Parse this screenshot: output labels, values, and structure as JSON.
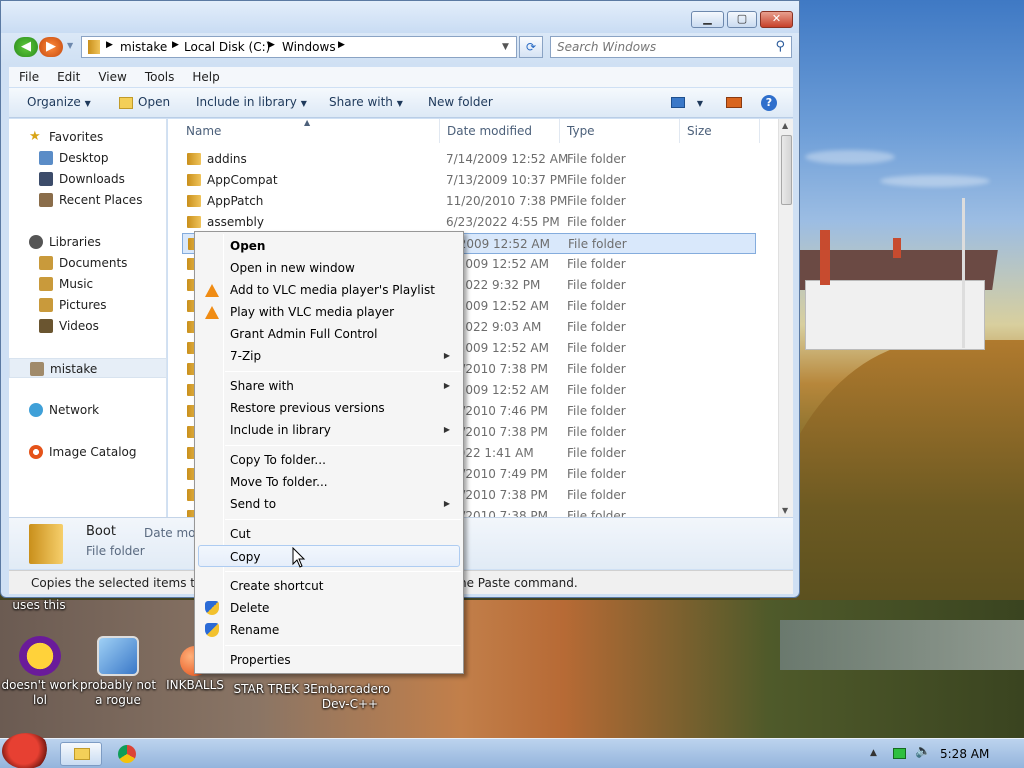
{
  "window": {
    "address": {
      "segments": [
        "mistake",
        "Local Disk (C:)",
        "Windows"
      ]
    },
    "search": {
      "placeholder": "Search Windows"
    },
    "menu": [
      "File",
      "Edit",
      "View",
      "Tools",
      "Help"
    ],
    "commands": {
      "organize": "Organize",
      "open": "Open",
      "include_in_library": "Include in library",
      "share_with": "Share with",
      "new_folder": "New folder"
    },
    "nav": {
      "favorites": "Favorites",
      "desktop": "Desktop",
      "downloads": "Downloads",
      "recent_places": "Recent Places",
      "libraries": "Libraries",
      "documents": "Documents",
      "music": "Music",
      "pictures": "Pictures",
      "videos": "Videos",
      "mistake": "mistake",
      "network": "Network",
      "image_catalog": "Image Catalog"
    },
    "columns": {
      "name": "Name",
      "date": "Date modified",
      "type": "Type",
      "size": "Size"
    },
    "files": [
      {
        "name": "addins",
        "date": "7/14/2009 12:52 AM",
        "type": "File folder"
      },
      {
        "name": "AppCompat",
        "date": "7/13/2009 10:37 PM",
        "type": "File folder"
      },
      {
        "name": "AppPatch",
        "date": "11/20/2010 7:38 PM",
        "type": "File folder"
      },
      {
        "name": "assembly",
        "date": "6/23/2022 4:55 PM",
        "type": "File folder"
      },
      {
        "name": "",
        "date": "4/2009 12:52 AM",
        "type": "File folder"
      },
      {
        "name": "",
        "date": "4/2009 12:52 AM",
        "type": "File folder"
      },
      {
        "name": "",
        "date": "3/2022 9:32 PM",
        "type": "File folder"
      },
      {
        "name": "",
        "date": "4/2009 12:52 AM",
        "type": "File folder"
      },
      {
        "name": "",
        "date": "3/2022 9:03 AM",
        "type": "File folder"
      },
      {
        "name": "",
        "date": "4/2009 12:52 AM",
        "type": "File folder"
      },
      {
        "name": "",
        "date": "20/2010 7:38 PM",
        "type": "File folder"
      },
      {
        "name": "",
        "date": "4/2009 12:52 AM",
        "type": "File folder"
      },
      {
        "name": "",
        "date": "20/2010 7:46 PM",
        "type": "File folder"
      },
      {
        "name": "",
        "date": "20/2010 7:38 PM",
        "type": "File folder"
      },
      {
        "name": "",
        "date": "/2022 1:41 AM",
        "type": "File folder"
      },
      {
        "name": "",
        "date": "20/2010 7:49 PM",
        "type": "File folder"
      },
      {
        "name": "",
        "date": "20/2010 7:38 PM",
        "type": "File folder"
      },
      {
        "name": "",
        "date": "20/2010 7:38 PM",
        "type": "File folder"
      }
    ],
    "details": {
      "name": "Boot",
      "type": "File folder",
      "date_label": "Date mod"
    },
    "status": {
      "left": "Copies the selected items to the",
      "right": "he Paste command."
    }
  },
  "context_menu": {
    "open": "Open",
    "open_new_window": "Open in new window",
    "vlc_playlist": "Add to VLC media player's Playlist",
    "vlc_play": "Play with VLC media player",
    "grant_admin": "Grant Admin Full Control",
    "seven_zip": "7-Zip",
    "share_with": "Share with",
    "restore": "Restore previous versions",
    "include_library": "Include in library",
    "copy_to": "Copy To folder...",
    "move_to": "Move To folder...",
    "send_to": "Send to",
    "cut": "Cut",
    "copy": "Copy",
    "create_shortcut": "Create shortcut",
    "delete": "Delete",
    "rename": "Rename",
    "properties": "Properties"
  },
  "desktop_icons": {
    "uses_this": "uses this",
    "yahoo_1": "doesn't work",
    "yahoo_2": "lol",
    "rogue_1": "probably not",
    "rogue_2": "a rogue",
    "inkballs": "INKBALLS",
    "startrek": "STAR TREK 3",
    "embarcadero_1": "Embarcadero",
    "embarcadero_2": "Dev-C++"
  },
  "taskbar": {
    "clock": "5:28 AM"
  },
  "colors": {
    "accent": "#3a78c8",
    "selection": "#d9e8fb",
    "menu_hover_border": "#aeccf1",
    "vlc": "#f08c14"
  }
}
